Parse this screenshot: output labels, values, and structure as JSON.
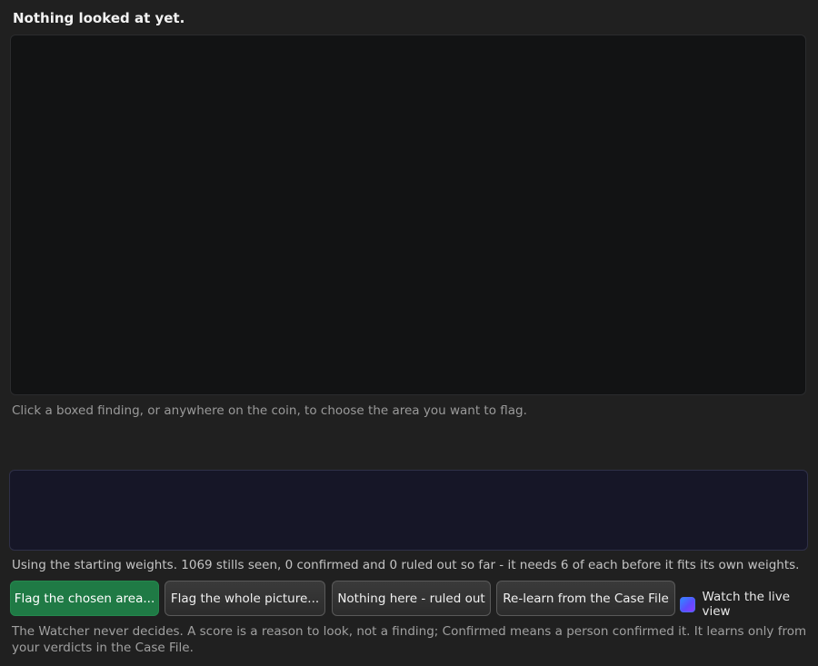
{
  "status": {
    "title": "Nothing looked at yet."
  },
  "viewer": {
    "hint": "Click a boxed finding, or anywhere on the coin, to choose the area you want to flag."
  },
  "learning": {
    "status_text": "Using the starting weights. 1069 stills seen, 0 confirmed and 0 ruled out so far - it needs 6 of each before it fits its own weights."
  },
  "actions": {
    "flag_chosen_label": "Flag the chosen area...",
    "flag_whole_label": "Flag the whole picture...",
    "rule_out_label": "Nothing here - ruled out",
    "relearn_label": "Re-learn from the Case File",
    "watch_live_label": "Watch the live view",
    "watch_live_checked": true
  },
  "footnote": "The Watcher never decides. A score is a reason to look, not a finding; Confirmed means a person confirmed it. It learns only from your verdicts in the Case File.",
  "colors": {
    "background": "#202020",
    "viewer": "#121314",
    "live_panel": "#161627",
    "primary": "#1f7a45",
    "toggle_accent": "#5c4cff"
  }
}
